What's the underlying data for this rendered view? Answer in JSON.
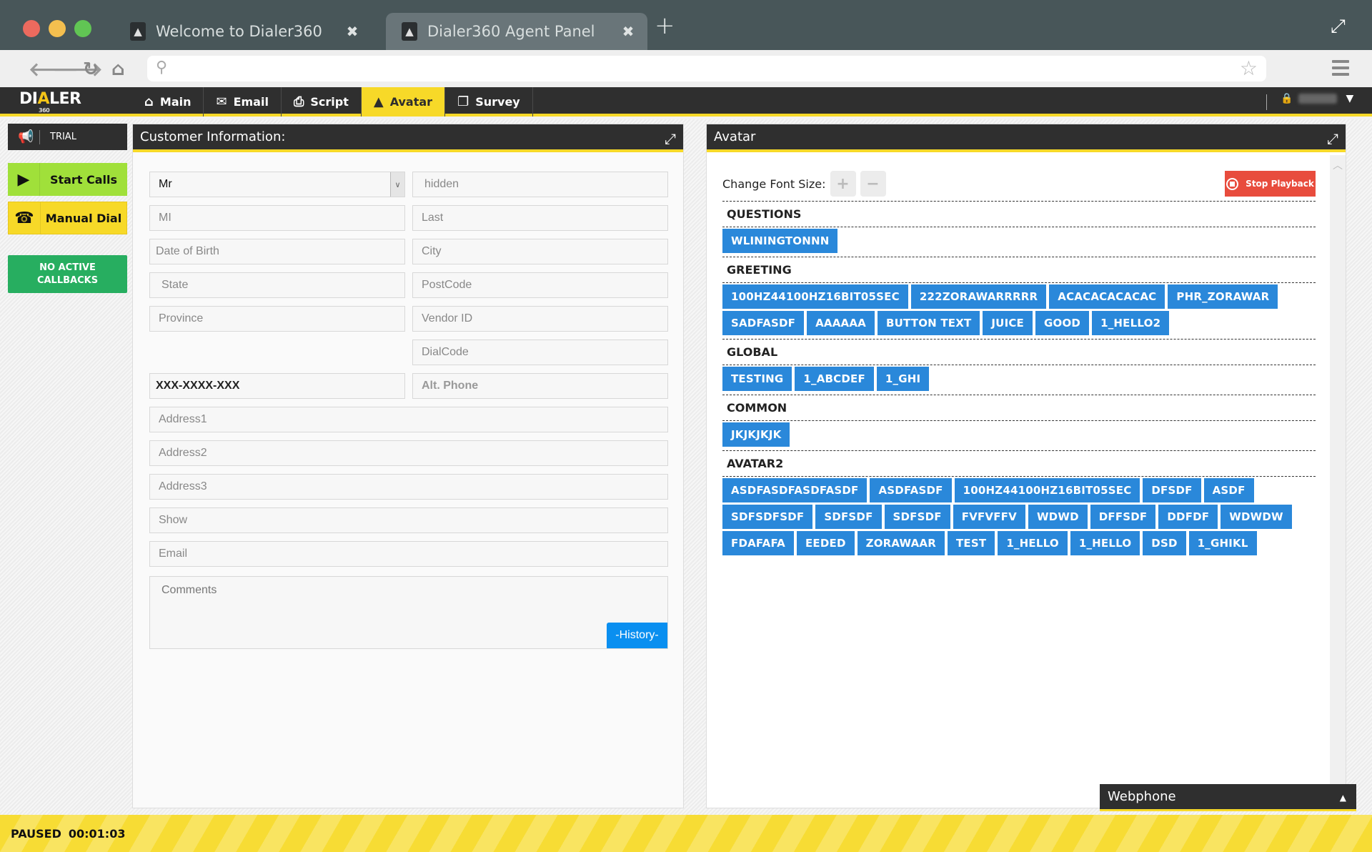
{
  "browser": {
    "tabs": [
      {
        "title": "Welcome to Dialer360",
        "active": false
      },
      {
        "title": "Dialer360 Agent Panel",
        "active": true
      }
    ],
    "url": ""
  },
  "app": {
    "logo": {
      "left": "DI",
      "mid": "A",
      "right": "LER",
      "sub": "360"
    },
    "nav": [
      {
        "label": "Main",
        "icon": "home-icon",
        "glyph": "⌂"
      },
      {
        "label": "Email",
        "icon": "envelope-icon",
        "glyph": "✉"
      },
      {
        "label": "Script",
        "icon": "script-file-icon",
        "glyph": "⎙"
      },
      {
        "label": "Avatar",
        "icon": "avatar-logo-icon",
        "glyph": "▲",
        "active": true
      },
      {
        "label": "Survey",
        "icon": "survey-icon",
        "glyph": "❐"
      }
    ],
    "user": {
      "name": "(blurred)"
    },
    "accent": "#f7d928"
  },
  "sidebar": {
    "trial_label": "TRIAL",
    "start_calls": "Start Calls",
    "manual_dial": "Manual Dial",
    "callbacks_line1": "NO ACTIVE",
    "callbacks_line2": "CALLBACKS"
  },
  "customer": {
    "title": "Customer Information:",
    "fields": {
      "title_select": "Mr",
      "first_name": "hidden",
      "mi": "MI",
      "last": "Last",
      "dob": "Date of Birth",
      "city": "City",
      "state": "State",
      "postcode": "PostCode",
      "province": "Province",
      "vendor_id": "Vendor ID",
      "dialcode": "DialCode",
      "phone": "XXX-XXXX-XXX",
      "alt_phone": "Alt. Phone",
      "address1": "Address1",
      "address2": "Address2",
      "address3": "Address3",
      "show": "Show",
      "email": "Email",
      "comments": "Comments"
    },
    "history_button": "-History-"
  },
  "avatar": {
    "title": "Avatar",
    "font_size_label": "Change Font Size:",
    "stop_playback": "Stop Playback",
    "sections": [
      {
        "title": "QUESTIONS",
        "buttons": [
          "WLININGTONNN"
        ]
      },
      {
        "title": "GREETING",
        "buttons": [
          "100HZ44100HZ16BIT05SEC",
          "222ZORAWARRRRR",
          "ACACACACACAC",
          "PHR_ZORAWAR",
          "SADFASDF",
          "AAAAAA",
          "BUTTON TEXT",
          "JUICE",
          "GOOD",
          "1_HELLO2"
        ]
      },
      {
        "title": "GLOBAL",
        "buttons": [
          "TESTING",
          "1_ABCDEF",
          "1_GHI"
        ]
      },
      {
        "title": "COMMON",
        "buttons": [
          "JKJKJKJK"
        ]
      },
      {
        "title": "AVATAR2",
        "buttons": [
          "ASDFASDFASDFASDF",
          "ASDFASDF",
          "100HZ44100HZ16BIT05SEC",
          "DFSDF",
          "ASDF",
          "SDFSDFSDF",
          "SDFSDF",
          "SDFSDF",
          "FVFVFFV",
          "WDWD",
          "DFFSDF",
          "DDFDF",
          "WDWDW",
          "FDAFAFA",
          "EEDED",
          "ZORAWAAR",
          "TEST",
          "1_HELLO",
          "1_HELLO",
          "DSD",
          "1_GHIKL"
        ]
      }
    ]
  },
  "webphone": {
    "label": "Webphone"
  },
  "status": {
    "state": "PAUSED",
    "timer": "00:01:03"
  }
}
